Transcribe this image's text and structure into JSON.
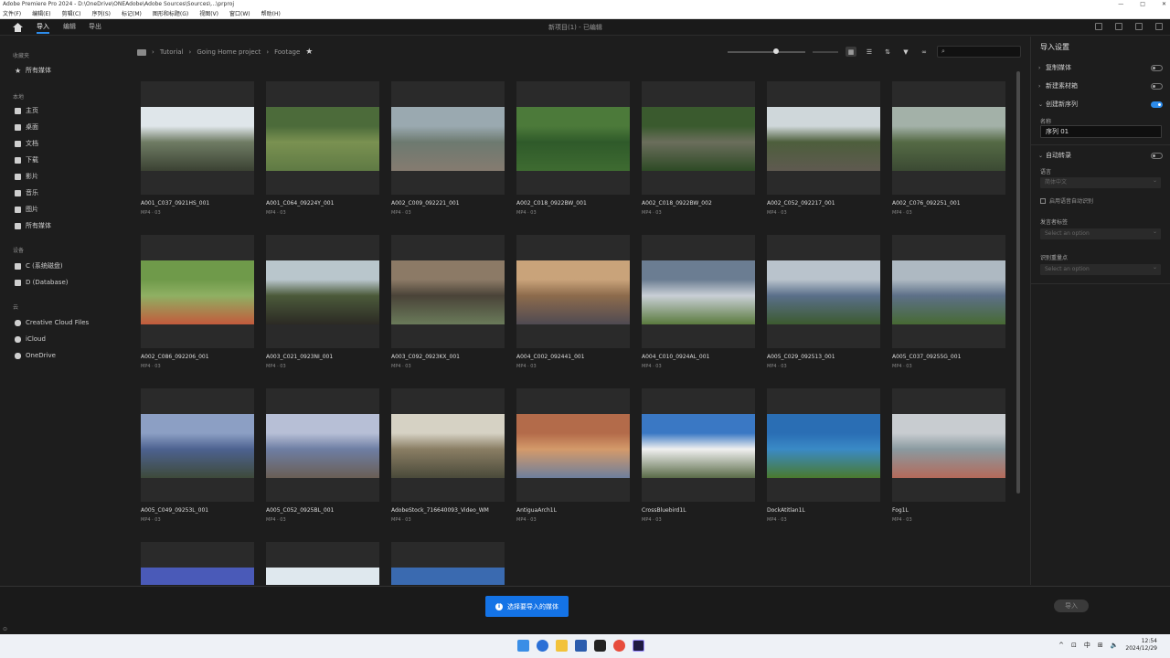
{
  "window": {
    "title": "Adobe Premiere Pro 2024 - D:\\OneDrive\\ONEAdobe\\Adobe Sources\\Sources\\...\\prproj",
    "controls": [
      "—",
      "□",
      "✕"
    ]
  },
  "menu": [
    "文件(F)",
    "编辑(E)",
    "剪辑(C)",
    "序列(S)",
    "标记(M)",
    "图形和标题(G)",
    "视图(V)",
    "窗口(W)",
    "帮助(H)"
  ],
  "app": {
    "tabs": [
      "导入",
      "编辑",
      "导出"
    ],
    "active_tab": 0,
    "project_title": "新项目(1) - 已编辑"
  },
  "sidebar": {
    "sections": [
      {
        "label": "收藏夹",
        "items": [
          "所有媒体"
        ]
      },
      {
        "label": "本地",
        "items": [
          "主页",
          "桌面",
          "文档",
          "下载",
          "影片",
          "音乐",
          "图片",
          "所有媒体"
        ]
      },
      {
        "label": "设备",
        "items": [
          "C (系统磁盘)",
          "D (Database)"
        ]
      },
      {
        "label": "云",
        "items": [
          "Creative Cloud Files",
          "iCloud",
          "OneDrive"
        ]
      }
    ]
  },
  "breadcrumb": [
    "Tutorial",
    "Going Home project",
    "Footage"
  ],
  "search": {
    "placeholder": ""
  },
  "clips": [
    {
      "name": "A001_C037_0921HS_001",
      "meta": "MP4 · 03",
      "colors": [
        "#dfe6ea",
        "#6f7c64",
        "#3b4233"
      ]
    },
    {
      "name": "A001_C064_09224Y_001",
      "meta": "MP4 · 03",
      "colors": [
        "#4c6b3a",
        "#7a9151",
        "#5f7a44"
      ]
    },
    {
      "name": "A002_C009_092221_001",
      "meta": "MP4 · 03",
      "colors": [
        "#9aa9b0",
        "#6d7a70",
        "#857b70"
      ]
    },
    {
      "name": "A002_C018_0922BW_001",
      "meta": "MP4 · 03",
      "colors": [
        "#4c7a3a",
        "#2f5a2a",
        "#3e6b31"
      ]
    },
    {
      "name": "A002_C018_0922BW_002",
      "meta": "MP4 · 03",
      "colors": [
        "#3a5a2e",
        "#6b6e5c",
        "#2d4a25"
      ]
    },
    {
      "name": "A002_C052_092217_001",
      "meta": "MP4 · 03",
      "colors": [
        "#cfd7da",
        "#4d5e3c",
        "#5f5a50"
      ]
    },
    {
      "name": "A002_C076_092251_001",
      "meta": "MP4 · 03",
      "colors": [
        "#a3b1a8",
        "#556a45",
        "#3b4a33"
      ]
    },
    {
      "name": "A002_C086_092206_001",
      "meta": "MP4 · 03",
      "colors": [
        "#6f9a4a",
        "#8fb063",
        "#c35a3c"
      ]
    },
    {
      "name": "A003_C021_0923NI_001",
      "meta": "MP4 · 03",
      "colors": [
        "#b9c6cc",
        "#4b5a3a",
        "#2c2a24"
      ]
    },
    {
      "name": "A003_C092_0923KX_001",
      "meta": "MP4 · 03",
      "colors": [
        "#8c7a66",
        "#4a4338",
        "#6a7b5a"
      ]
    },
    {
      "name": "A004_C002_092441_001",
      "meta": "MP4 · 03",
      "colors": [
        "#c9a37a",
        "#8d6b4c",
        "#4f4a52"
      ]
    },
    {
      "name": "A004_C010_0924AL_001",
      "meta": "MP4 · 03",
      "colors": [
        "#6b7d92",
        "#c9cfd6",
        "#5a7a3e"
      ]
    },
    {
      "name": "A005_C029_092513_001",
      "meta": "MP4 · 03",
      "colors": [
        "#b9c3cc",
        "#5a6f8a",
        "#3c5a2f"
      ]
    },
    {
      "name": "A005_C037_09255G_001",
      "meta": "MP4 · 03",
      "colors": [
        "#aeb9c2",
        "#5d7088",
        "#476a33"
      ]
    },
    {
      "name": "A005_C049_09253L_001",
      "meta": "MP4 · 03",
      "colors": [
        "#8c9fc4",
        "#4d6290",
        "#3e4a3a"
      ]
    },
    {
      "name": "A005_C052_0925BL_001",
      "meta": "MP4 · 03",
      "colors": [
        "#b7bfd6",
        "#6e7ea3",
        "#6a5f55"
      ]
    },
    {
      "name": "AdobeStock_716640093_Video_WM",
      "meta": "MP4 · 03",
      "colors": [
        "#d6d2c4",
        "#8a7e64",
        "#4a4a3a"
      ]
    },
    {
      "name": "AntiguaArch1L",
      "meta": "MP4 · 03",
      "colors": [
        "#b36b4a",
        "#d49a6a",
        "#6e7f9c"
      ]
    },
    {
      "name": "CrossBluebird1L",
      "meta": "MP4 · 03",
      "colors": [
        "#3a78c4",
        "#f0f0f0",
        "#5a6b48"
      ]
    },
    {
      "name": "DockAtitlan1L",
      "meta": "MP4 · 03",
      "colors": [
        "#2a6eb4",
        "#3a8ac6",
        "#4a7a2e"
      ]
    },
    {
      "name": "Fog1L",
      "meta": "MP4 · 03",
      "colors": [
        "#c8ccd0",
        "#8a9aa0",
        "#b46a5a"
      ]
    },
    {
      "name": "",
      "meta": "",
      "colors": [
        "#4a5ab8",
        "#2a3a8a",
        "#c8a050"
      ]
    },
    {
      "name": "",
      "meta": "",
      "colors": [
        "#dfe8ee",
        "#9ab6c8",
        "#e6e6e6"
      ]
    },
    {
      "name": "",
      "meta": "",
      "colors": [
        "#3a6ab0",
        "#dfe4ea",
        "#6a8a9a"
      ]
    }
  ],
  "right_panel": {
    "title": "导入设置",
    "rows": [
      {
        "label": "复制媒体",
        "on": false,
        "chev": "›"
      },
      {
        "label": "新建素材箱",
        "on": false,
        "chev": "›"
      },
      {
        "label": "创建新序列",
        "on": true,
        "chev": "⌄"
      }
    ],
    "name_label": "名称",
    "name_value": "序列 01",
    "auto_transcribe": {
      "label": "自动转录",
      "on": false
    },
    "language_label": "语言",
    "language_value": "简体中文",
    "checkbox_label": "启用语音自动识别",
    "speaker_label": "发言者标签",
    "speaker_placeholder": "Select an option",
    "recognition_label": "识别重量点",
    "recognition_placeholder": "Select an option"
  },
  "bottom": {
    "message": "选择要导入的媒体",
    "import_button": "导入"
  },
  "taskbar": {
    "tray_text": [
      "^",
      "⊡",
      "中",
      "⊞",
      "🔈"
    ],
    "time": "12:54",
    "date": "2024/12/29"
  }
}
